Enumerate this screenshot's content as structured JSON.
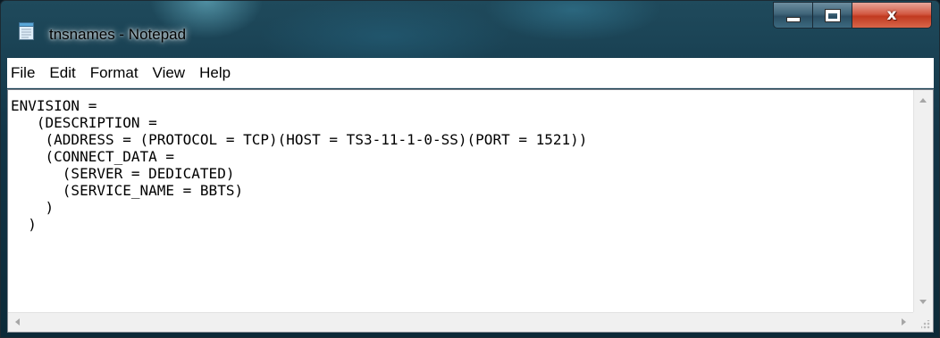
{
  "window": {
    "title": "tnsnames - Notepad",
    "app_icon": "notepad-icon"
  },
  "caption_buttons": {
    "minimize_icon": "minimize-icon",
    "maximize_icon": "maximize-icon",
    "close_label": "x"
  },
  "menubar": {
    "items": [
      {
        "label": "File"
      },
      {
        "label": "Edit"
      },
      {
        "label": "Format"
      },
      {
        "label": "View"
      },
      {
        "label": "Help"
      }
    ]
  },
  "editor": {
    "lines": [
      "ENVISION =",
      "   (DESCRIPTION =",
      "    (ADDRESS = (PROTOCOL = TCP)(HOST = TS3-11-1-0-SS)(PORT = 1521))",
      "    (CONNECT_DATA =",
      "      (SERVER = DEDICATED)",
      "      (SERVICE_NAME = BBTS)",
      "    )",
      "  )"
    ]
  },
  "scrollbars": {
    "up_icon": "scroll-up-arrow-icon",
    "down_icon": "scroll-down-arrow-icon",
    "left_icon": "scroll-left-arrow-icon",
    "right_icon": "scroll-right-arrow-icon",
    "grip_icon": "resize-grip-icon"
  }
}
